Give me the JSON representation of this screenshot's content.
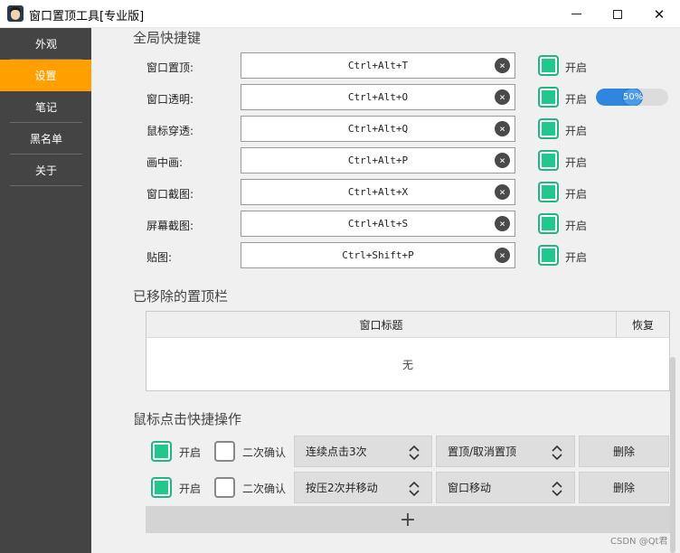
{
  "window": {
    "title": "窗口置顶工具[专业版]",
    "minimize": "—",
    "maximize": "□",
    "close": "✕"
  },
  "sidebar": {
    "items": [
      {
        "label": "外观",
        "active": false
      },
      {
        "label": "设置",
        "active": true
      },
      {
        "label": "笔记",
        "active": false
      },
      {
        "label": "黑名单",
        "active": false
      },
      {
        "label": "关于",
        "active": false
      }
    ],
    "accent": "#ffa000"
  },
  "shortcuts": {
    "title": "全局快捷键",
    "rows": [
      {
        "label": "窗口置顶:",
        "keys": "Ctrl+Alt+T",
        "enabled_label": "开启",
        "enabled": true
      },
      {
        "label": "窗口透明:",
        "keys": "Ctrl+Alt+O",
        "enabled_label": "开启",
        "enabled": true
      },
      {
        "label": "鼠标穿透:",
        "keys": "Ctrl+Alt+Q",
        "enabled_label": "开启",
        "enabled": true
      },
      {
        "label": "画中画:",
        "keys": "Ctrl+Alt+P",
        "enabled_label": "开启",
        "enabled": true
      },
      {
        "label": "窗口截图:",
        "keys": "Ctrl+Alt+X",
        "enabled_label": "开启",
        "enabled": true
      },
      {
        "label": "屏幕截图:",
        "keys": "Ctrl+Alt+S",
        "enabled_label": "开启",
        "enabled": true
      },
      {
        "label": "贴图:",
        "keys": "Ctrl+Shift+P",
        "enabled_label": "开启",
        "enabled": true
      }
    ],
    "opacity": {
      "label": "50%",
      "value": 0.5
    },
    "clear_icon": "×",
    "check_color": "#22c78c"
  },
  "removed": {
    "title": "已移除的置顶栏",
    "columns": [
      "窗口标题",
      "恢复"
    ],
    "empty_text": "无"
  },
  "mouse": {
    "title": "鼠标点击快捷操作",
    "rows": [
      {
        "enabled_label": "开启",
        "enabled": true,
        "confirm_label": "二次确认",
        "confirm": false,
        "trigger": "连续点击3次",
        "action": "置顶/取消置顶",
        "delete_label": "删除"
      },
      {
        "enabled_label": "开启",
        "enabled": true,
        "confirm_label": "二次确认",
        "confirm": false,
        "trigger": "按压2次并移动",
        "action": "窗口移动",
        "delete_label": "删除"
      }
    ],
    "add_label": "+"
  },
  "watermark": "CSDN @Qt君"
}
